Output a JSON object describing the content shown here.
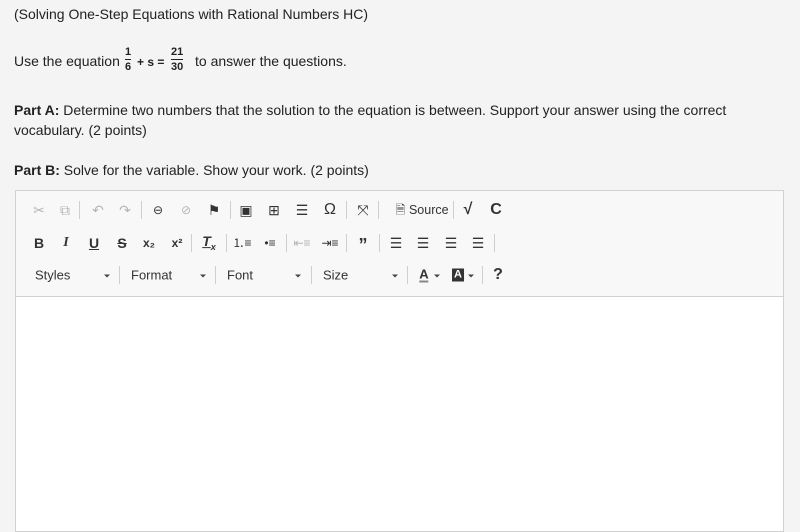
{
  "question": {
    "title": "(Solving One-Step Equations with Rational Numbers HC)",
    "intro_before": "Use the equation",
    "eq_num1": "1",
    "eq_den1": "6",
    "eq_mid": "+ s =",
    "eq_num2": "21",
    "eq_den2": "30",
    "intro_after": "to answer the questions.",
    "part_a_label": "Part A:",
    "part_a_text": " Determine two numbers that the solution to the equation is between. Support your answer using the correct",
    "part_a_text2": "vocabulary. (2 points)",
    "part_b_label": "Part B:",
    "part_b_text": " Solve for the variable. Show your work. (2 points)"
  },
  "toolbar": {
    "source_label": "Source",
    "styles": "Styles",
    "format": "Format",
    "font": "Font",
    "size": "Size",
    "help": "?"
  },
  "editor": {
    "content": ""
  }
}
